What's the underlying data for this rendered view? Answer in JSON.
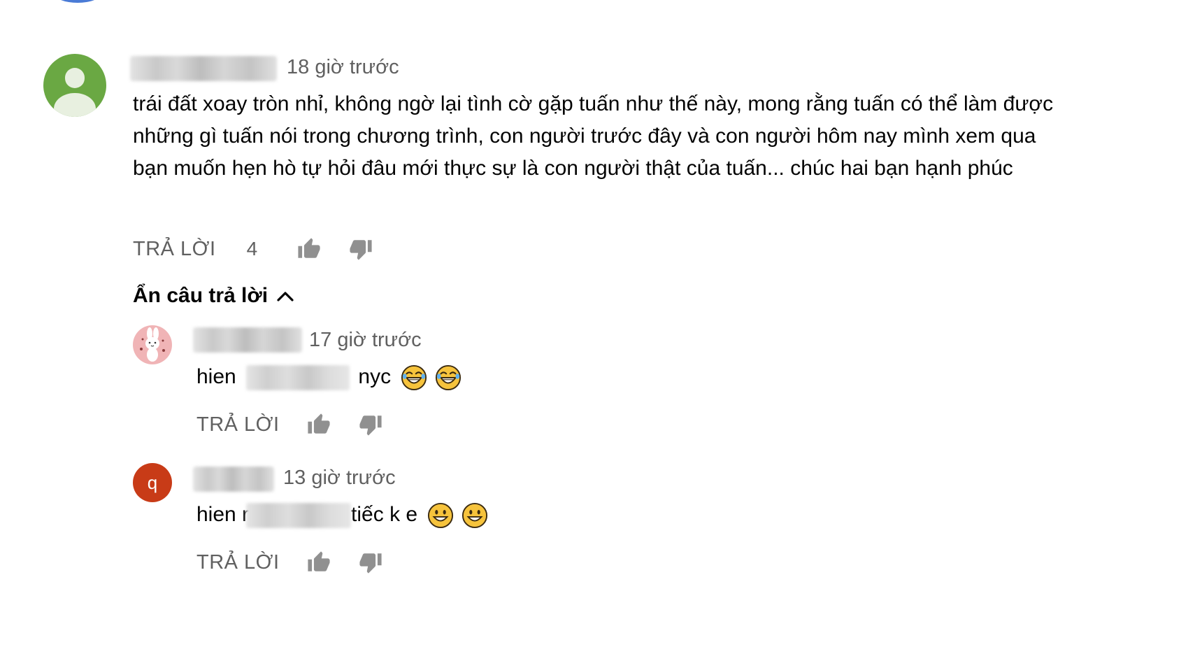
{
  "colors": {
    "text_primary": "#030303",
    "text_secondary": "#606060",
    "avatar_default_bg": "#6aa843",
    "avatar_q_bg": "#c83b17",
    "avatar_bunny_bg": "#f0b4b6"
  },
  "main_comment": {
    "timestamp": "18 giờ trước",
    "text": "trái đất xoay tròn nhỉ, không ngờ lại tình cờ gặp tuấn như thế này, mong rằng tuấn có thể làm được những gì tuấn nói trong chương trình, con người trước đây và con người hôm nay mình xem qua bạn muốn hẹn hò tự hỏi đâu mới thực sự là con người thật của tuấn... chúc hai bạn hạnh phúc",
    "reply_label": "TRẢ LỜI",
    "like_count": "4",
    "avatar_icon": "default-user-icon"
  },
  "replies_toggle": {
    "label": "Ẩn câu trả lời",
    "icon": "chevron-up-icon"
  },
  "replies": [
    {
      "timestamp": "17 giờ trước",
      "text_start": "hien",
      "text_end": "nyc",
      "emojis": [
        "rolling-on-floor-laughing-emoji",
        "rolling-on-floor-laughing-emoji"
      ],
      "reply_label": "TRẢ LỜI",
      "avatar_icon": "bunny-avatar-icon"
    },
    {
      "timestamp": "13 giờ trước",
      "text_start": "hien r",
      "text_end": "tiếc k e",
      "emojis": [
        "grinning-face-emoji",
        "grinning-face-emoji"
      ],
      "reply_label": "TRẢ LỜI",
      "avatar_letter": "q"
    }
  ]
}
